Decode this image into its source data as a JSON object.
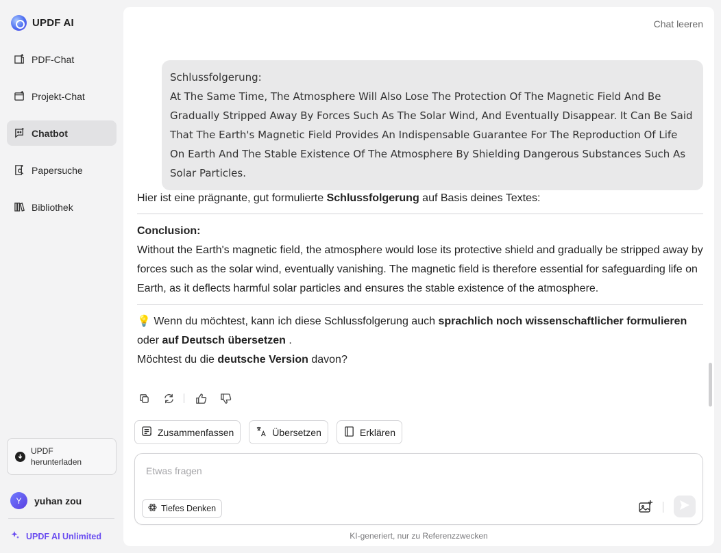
{
  "brand": {
    "name": "UPDF AI"
  },
  "sidebar": {
    "items": [
      {
        "label": "PDF-Chat",
        "icon": "pdf-chat-icon",
        "active": false
      },
      {
        "label": "Projekt-Chat",
        "icon": "project-chat-icon",
        "active": false
      },
      {
        "label": "Chatbot",
        "icon": "chatbot-icon",
        "active": true
      },
      {
        "label": "Papersuche",
        "icon": "paper-search-icon",
        "active": false
      },
      {
        "label": "Bibliothek",
        "icon": "library-icon",
        "active": false
      }
    ],
    "download_line1": "UPDF",
    "download_line2": "herunterladen",
    "user_initial": "Y",
    "user_name": "yuhan zou",
    "unlimited_label": "UPDF AI Unlimited"
  },
  "header": {
    "clear_chat": "Chat leeren"
  },
  "user_message": {
    "title": "Schlussfolgerung:",
    "body": "At The Same Time, The Atmosphere Will Also Lose The Protection Of The Magnetic Field And Be Gradually Stripped Away By Forces Such As The Solar Wind, And Eventually Disappear. It Can Be Said That The Earth's Magnetic Field Provides An Indispensable Guarantee For The Reproduction Of Life On Earth And The Stable Existence Of The Atmosphere By Shielding Dangerous Substances Such As Solar Particles."
  },
  "answer": {
    "intro_before": "Hier ist eine prägnante, gut formulierte ",
    "intro_bold": "Schlussfolgerung",
    "intro_after": " auf Basis deines Textes:",
    "conclusion_label": "Conclusion:",
    "conclusion_text": "Without the Earth's magnetic field, the atmosphere would lose its protective shield and gradually be stripped away by forces such as the solar wind, eventually vanishing. The magnetic field is therefore essential for safeguarding life on Earth, as it deflects harmful solar particles and ensures the stable existence of the atmosphere.",
    "tip_emoji": "💡",
    "tip_before": " Wenn du möchtest, kann ich diese Schlussfolgerung auch ",
    "tip_bold1": "sprachlich noch wissenschaftlicher formulieren",
    "tip_mid": " oder ",
    "tip_bold2": "auf Deutsch übersetzen",
    "tip_after": " .",
    "question_before": "Möchtest du die ",
    "question_bold": "deutsche Version",
    "question_after": " davon?"
  },
  "quick_actions": [
    {
      "label": "Zusammenfassen",
      "icon": "summarize-icon"
    },
    {
      "label": "Übersetzen",
      "icon": "translate-icon"
    },
    {
      "label": "Erklären",
      "icon": "explain-icon"
    }
  ],
  "composer": {
    "placeholder": "Etwas fragen",
    "value": "",
    "deep_think": "Tiefes Denken"
  },
  "footnote": "KI-generiert, nur zu Referenzzwecken",
  "colors": {
    "accent": "#6a4df0",
    "active_nav": "#e2e2e4",
    "bubble": "#e9e9ea"
  }
}
